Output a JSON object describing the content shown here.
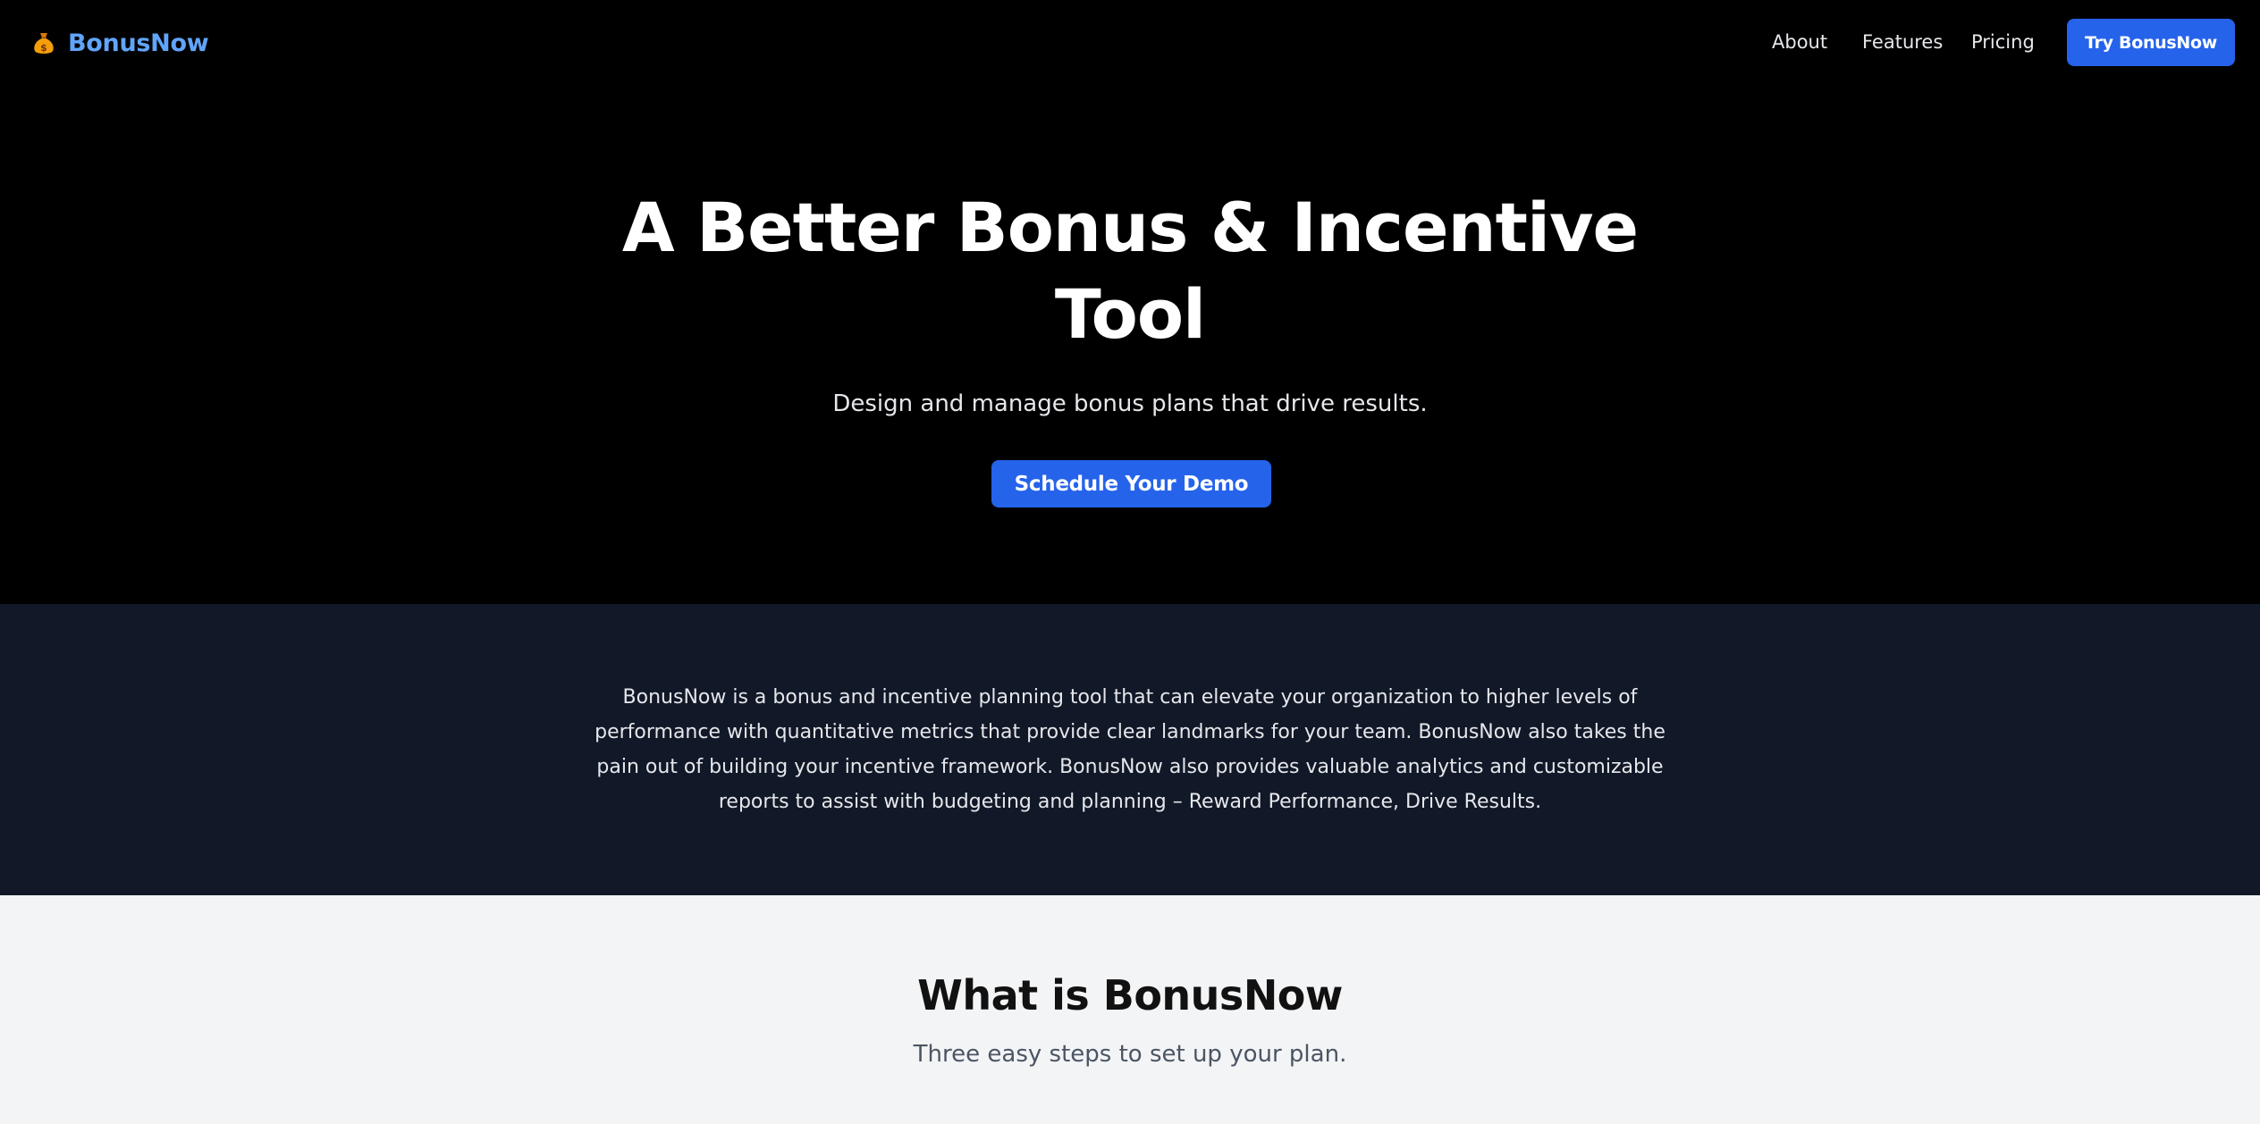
{
  "nav": {
    "brand": "BonusNow",
    "brand_icon": "money-bag-icon",
    "links": [
      "About",
      "Features",
      "Pricing"
    ],
    "cta": "Try BonusNow"
  },
  "hero": {
    "title": "A Better Bonus & Incentive Tool",
    "subtitle": "Design and manage bonus plans that drive results.",
    "cta": "Schedule Your Demo"
  },
  "about": {
    "text": "BonusNow is a bonus and incentive planning tool that can elevate your organization to higher levels of performance with quantitative metrics that provide clear landmarks for your team. BonusNow also takes the pain out of building your incentive framework. BonusNow also provides valuable analytics and customizable reports to assist with budgeting and planning – Reward Performance, Drive Results."
  },
  "whatis": {
    "title": "What is BonusNow",
    "subtitle": "Three easy steps to set up your plan."
  },
  "colors": {
    "accent": "#2563eb",
    "brand": "#60a5fa",
    "hero_bg": "#000000",
    "about_bg": "#111827",
    "light_bg": "#f3f4f6"
  }
}
